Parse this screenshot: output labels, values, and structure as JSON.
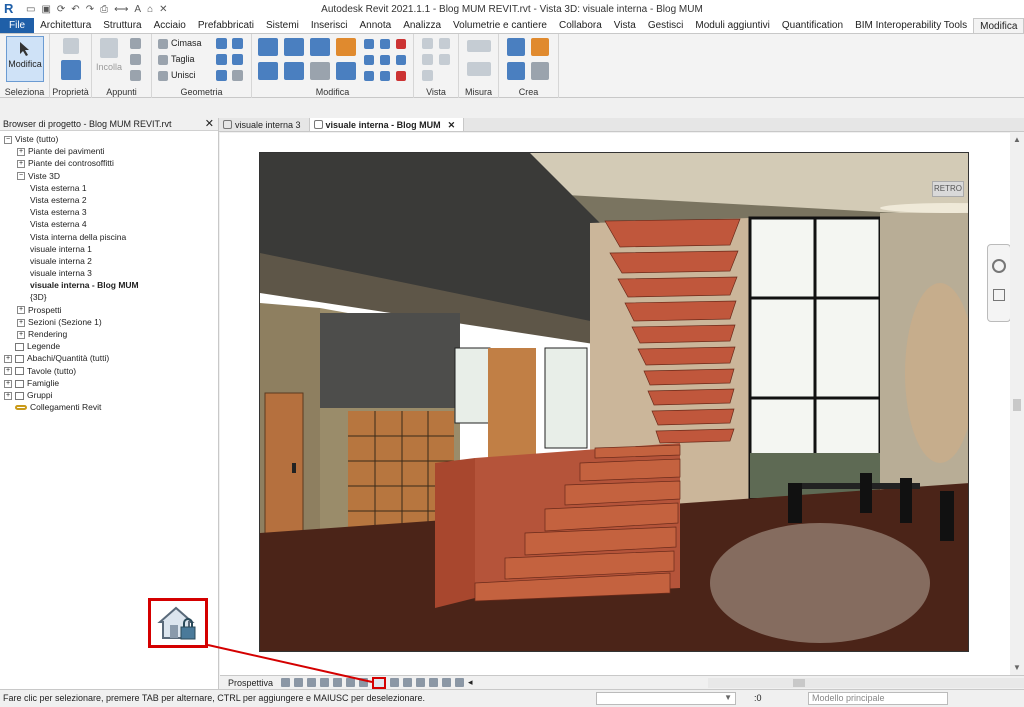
{
  "window": {
    "app_icon": "R",
    "title": "Autodesk Revit 2021.1.1 - Blog MUM REVIT.rvt - Vista 3D: visuale interna - Blog MUM"
  },
  "ribbon_tabs": [
    {
      "label": "File",
      "state": "file"
    },
    {
      "label": "Architettura"
    },
    {
      "label": "Struttura"
    },
    {
      "label": "Acciaio"
    },
    {
      "label": "Prefabbricati"
    },
    {
      "label": "Sistemi"
    },
    {
      "label": "Inserisci"
    },
    {
      "label": "Annota"
    },
    {
      "label": "Analizza"
    },
    {
      "label": "Volumetrie e cantiere"
    },
    {
      "label": "Collabora"
    },
    {
      "label": "Vista"
    },
    {
      "label": "Gestisci"
    },
    {
      "label": "Moduli aggiuntivi"
    },
    {
      "label": "Quantification"
    },
    {
      "label": "BIM Interoperability Tools"
    },
    {
      "label": "Modifica",
      "state": "active"
    }
  ],
  "ribbon": {
    "modify_button": "Modifica",
    "panels": {
      "seleziona": "Seleziona",
      "proprieta": "Proprietà",
      "appunti": "Appunti",
      "geometria": "Geometria",
      "modifica": "Modifica",
      "vista": "Vista",
      "misura": "Misura",
      "crea": "Crea"
    },
    "paste": "Incolla",
    "geometry_tools": [
      "Cimasa",
      "Taglia",
      "Unisci"
    ]
  },
  "browser": {
    "title": "Browser di progetto - Blog MUM REVIT.rvt",
    "tree": [
      {
        "label": "Viste (tutto)",
        "level": 0,
        "expander": "−"
      },
      {
        "label": "Piante dei pavimenti",
        "level": 1,
        "expander": "+"
      },
      {
        "label": "Piante dei controsoffitti",
        "level": 1,
        "expander": "+"
      },
      {
        "label": "Viste 3D",
        "level": 1,
        "expander": "−"
      },
      {
        "label": "Vista esterna 1",
        "level": 2
      },
      {
        "label": "Vista esterna 2",
        "level": 2
      },
      {
        "label": "Vista esterna 3",
        "level": 2
      },
      {
        "label": "Vista esterna 4",
        "level": 2
      },
      {
        "label": "Vista interna della piscina",
        "level": 2
      },
      {
        "label": "visuale interna 1",
        "level": 2
      },
      {
        "label": "visuale interna 2",
        "level": 2
      },
      {
        "label": "visuale interna 3",
        "level": 2
      },
      {
        "label": "visuale interna - Blog MUM",
        "level": 2,
        "selected": true
      },
      {
        "label": "{3D}",
        "level": 2
      },
      {
        "label": "Prospetti",
        "level": 1,
        "expander": "+"
      },
      {
        "label": "Sezioni (Sezione 1)",
        "level": 1,
        "expander": "+"
      },
      {
        "label": "Rendering",
        "level": 1,
        "expander": "+"
      },
      {
        "label": "Legende",
        "level": 0,
        "icon": "legend-icon"
      },
      {
        "label": "Abachi/Quantità (tutti)",
        "level": 0,
        "expander": "+",
        "icon": "schedule-icon"
      },
      {
        "label": "Tavole (tutto)",
        "level": 0,
        "expander": "+",
        "icon": "sheet-icon"
      },
      {
        "label": "Famiglie",
        "level": 0,
        "expander": "+",
        "icon": "family-icon"
      },
      {
        "label": "Gruppi",
        "level": 0,
        "expander": "+",
        "icon": "group-icon"
      },
      {
        "label": "Collegamenti Revit",
        "level": 0,
        "icon": "link-icon"
      }
    ]
  },
  "view_tabs": [
    {
      "label": "visuale interna 3"
    },
    {
      "label": "visuale interna - Blog MUM",
      "active": true
    }
  ],
  "viewcube": {
    "label": "RETRO"
  },
  "view_control_bar": {
    "label": "Prospettiva"
  },
  "statusbar": {
    "message": "Fare clic per selezionare, premere TAB per alternare, CTRL per aggiungere e MAIUSC per deselezionare.",
    "worksharing": ":0",
    "model": "Modello principale"
  },
  "colors": {
    "file_tab": "#1f5fa8",
    "callout": "#d40000",
    "brick": "#b5543a"
  }
}
